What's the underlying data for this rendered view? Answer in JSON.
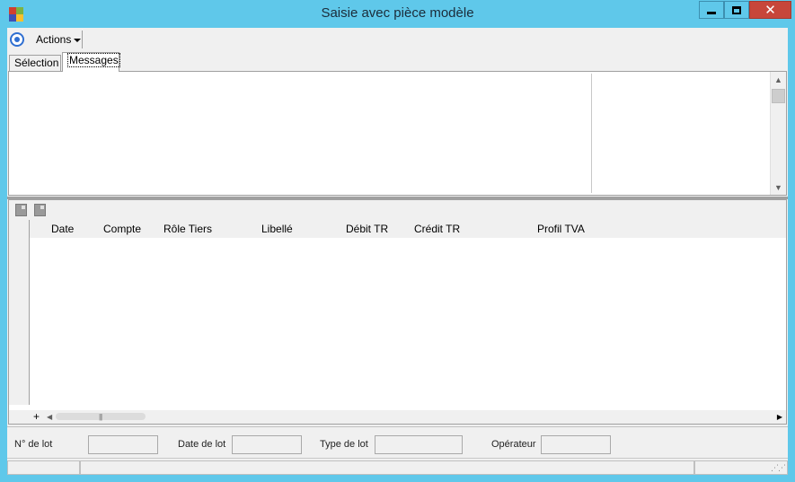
{
  "window": {
    "title": "Saisie avec pièce modèle",
    "minimize_label": "",
    "maximize_label": "",
    "close_label": "✕"
  },
  "toolbar": {
    "actions_label": "Actions"
  },
  "tabs": [
    {
      "label": "Sélection"
    },
    {
      "label": "Messages"
    }
  ],
  "grid": {
    "columns": [
      "Date",
      "Compte",
      "Rôle Tiers",
      "Libellé",
      "Débit TR",
      "Crédit TR",
      "Profil TVA"
    ],
    "add_row_label": "+"
  },
  "lot_info": {
    "lot_number_label": "N° de lot",
    "lot_number_value": "",
    "lot_date_label": "Date de lot",
    "lot_date_value": "",
    "lot_type_label": "Type de lot",
    "lot_type_value": "",
    "operator_label": "Opérateur",
    "operator_value": ""
  },
  "colors": {
    "window_frame": "#5fc8ea",
    "close_button": "#c7463a",
    "accent_icon": "#2f6fd1"
  }
}
